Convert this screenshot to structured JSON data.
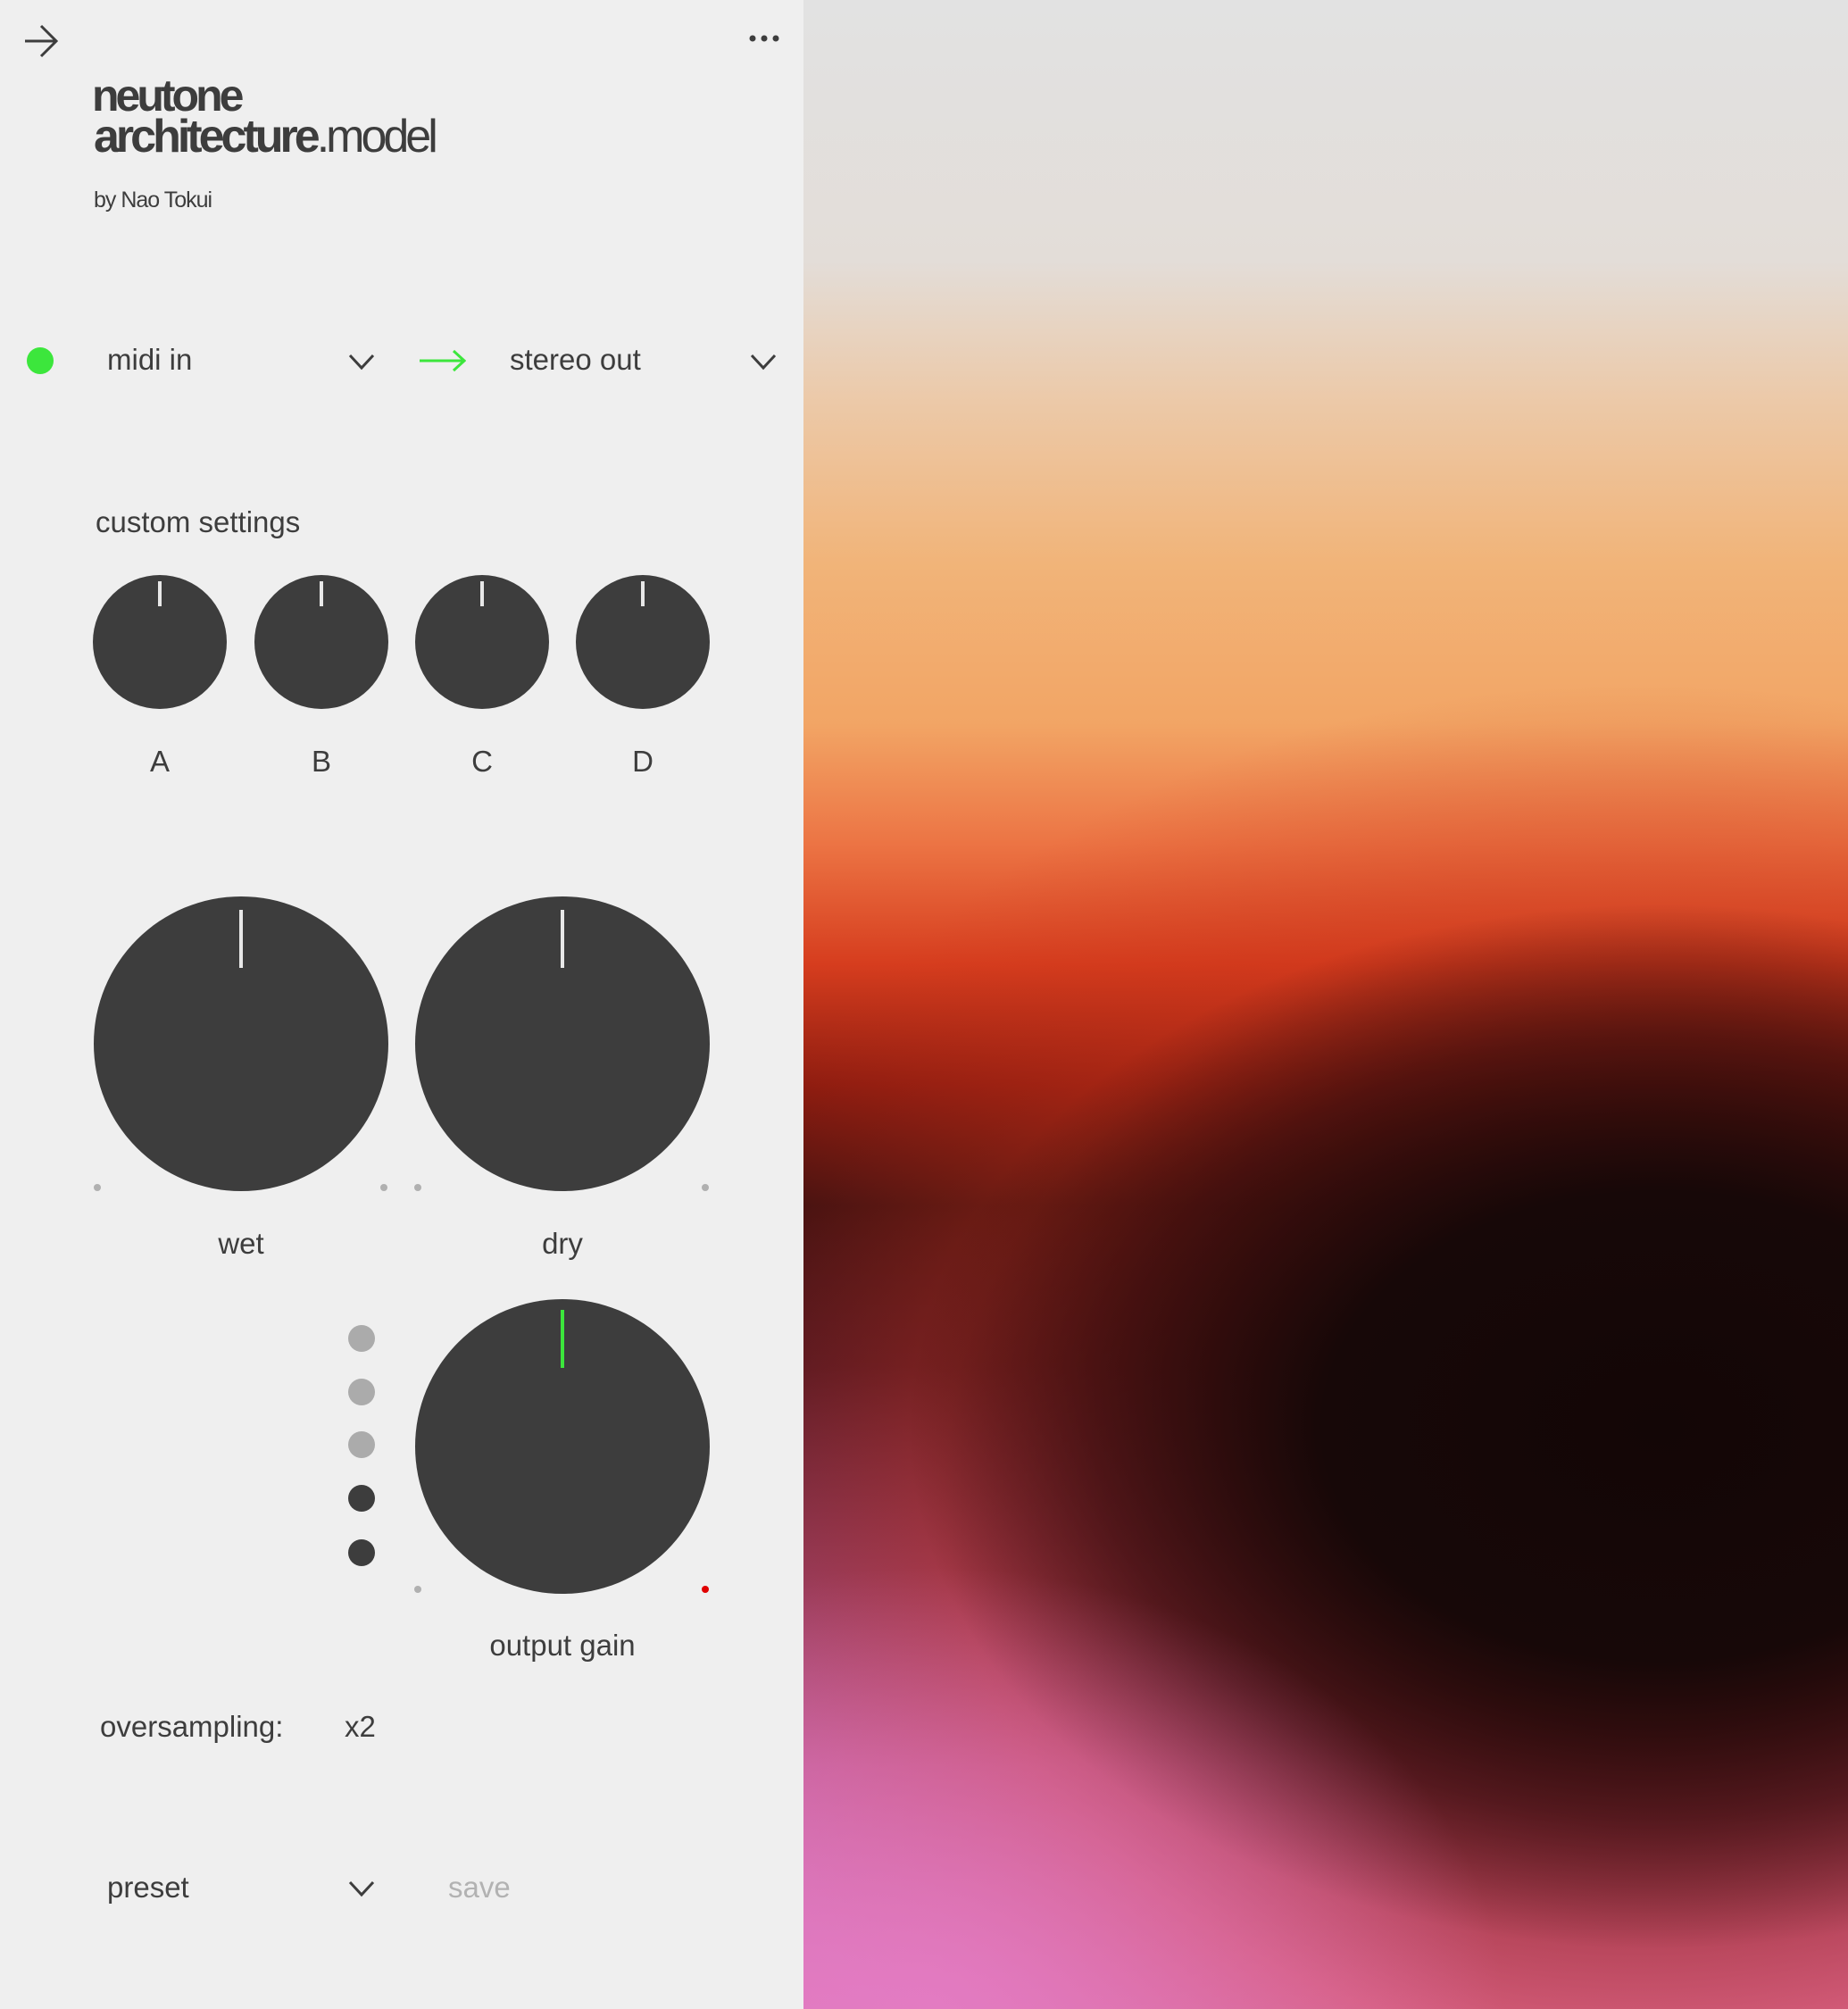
{
  "header": {
    "back_icon": "arrow-right-icon",
    "menu_icon": "more-horizontal-icon"
  },
  "title": {
    "brand": "neutone",
    "model_name": "architecture",
    "model_suffix": ".model",
    "author": "by Nao Tokui"
  },
  "io": {
    "status_color": "#3ce63c",
    "input": "midi in",
    "output": "stereo out",
    "arrow_color": "#3ce63c"
  },
  "custom_settings": {
    "heading": "custom settings",
    "knobs": [
      {
        "label": "A"
      },
      {
        "label": "B"
      },
      {
        "label": "C"
      },
      {
        "label": "D"
      }
    ]
  },
  "mix": {
    "wet_label": "wet",
    "dry_label": "dry"
  },
  "output": {
    "label": "output gain",
    "indicator_color": "#3ce63c",
    "clip_color": "#e00000",
    "meter_leds_lit": 2,
    "meter_leds_total": 5
  },
  "oversampling": {
    "label": "oversampling:",
    "value": "x2"
  },
  "preset": {
    "label": "preset",
    "save_label": "save"
  }
}
